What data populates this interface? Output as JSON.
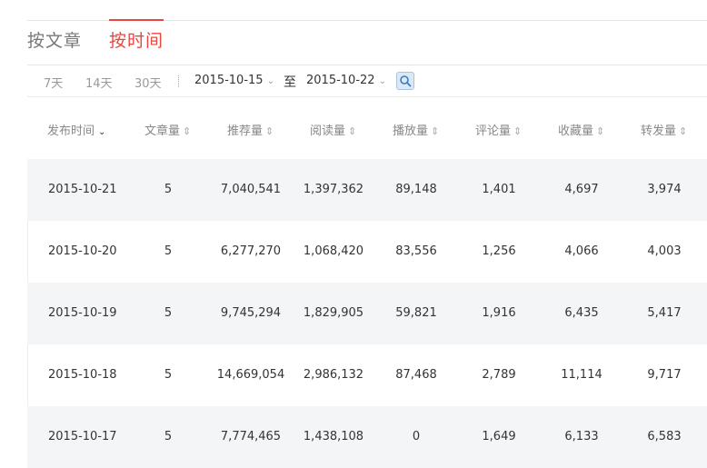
{
  "tabs": [
    {
      "label": "按文章",
      "active": false
    },
    {
      "label": "按时间",
      "active": true
    }
  ],
  "accent_color": "#e8473f",
  "filters": {
    "quick_ranges": [
      "7天",
      "14天",
      "30天"
    ],
    "start_date": "2015-10-15",
    "to_label": "至",
    "end_date": "2015-10-22",
    "search_icon": "search-icon"
  },
  "table": {
    "columns": [
      "发布时间",
      "文章量",
      "推荐量",
      "阅读量",
      "播放量",
      "评论量",
      "收藏量",
      "转发量"
    ],
    "rows": [
      [
        "2015-10-21",
        "5",
        "7,040,541",
        "1,397,362",
        "89,148",
        "1,401",
        "4,697",
        "3,974"
      ],
      [
        "2015-10-20",
        "5",
        "6,277,270",
        "1,068,420",
        "83,556",
        "1,256",
        "4,066",
        "4,003"
      ],
      [
        "2015-10-19",
        "5",
        "9,745,294",
        "1,829,905",
        "59,821",
        "1,916",
        "6,435",
        "5,417"
      ],
      [
        "2015-10-18",
        "5",
        "14,669,054",
        "2,986,132",
        "87,468",
        "2,789",
        "11,114",
        "9,717"
      ],
      [
        "2015-10-17",
        "5",
        "7,774,465",
        "1,438,108",
        "0",
        "1,649",
        "6,133",
        "6,583"
      ]
    ]
  }
}
